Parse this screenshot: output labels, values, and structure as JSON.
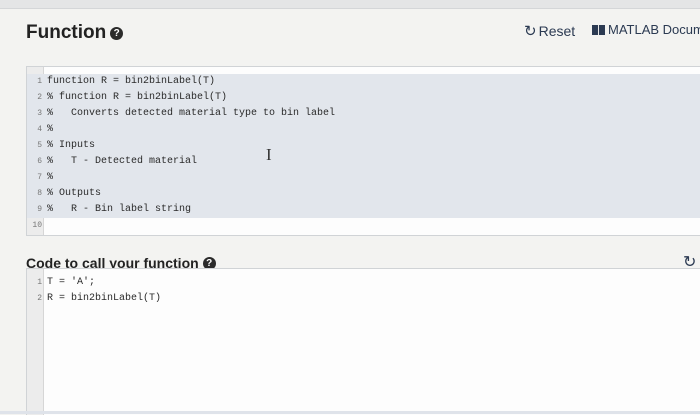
{
  "header": {
    "title": "Function",
    "help_glyph": "?",
    "reset_label": "Reset",
    "reset_icon": "refresh-icon",
    "docs_label": "MATLAB Docume",
    "docs_icon": "book-icon"
  },
  "editor": {
    "lines": [
      {
        "num": "1",
        "text": "function R = bin2binLabel(T)"
      },
      {
        "num": "2",
        "text": "% function R = bin2binLabel(T)"
      },
      {
        "num": "3",
        "text": "%   Converts detected material type to bin label"
      },
      {
        "num": "4",
        "text": "%"
      },
      {
        "num": "5",
        "text": "% Inputs"
      },
      {
        "num": "6",
        "text": "%   T - Detected material"
      },
      {
        "num": "7",
        "text": "%"
      },
      {
        "num": "8",
        "text": "% Outputs"
      },
      {
        "num": "9",
        "text": "%   R - Bin label string"
      },
      {
        "num": "10",
        "text": ""
      }
    ],
    "cursor_glyph": "I"
  },
  "call_section": {
    "title": "Code to call your function",
    "help_glyph": "?",
    "reset_icon": "refresh-icon",
    "lines": [
      {
        "num": "1",
        "text": "T = 'A';"
      },
      {
        "num": "2",
        "text": "R = bin2binLabel(T)"
      }
    ]
  },
  "colors": {
    "highlight": "#e2e6ec",
    "link": "#2b3a52"
  }
}
